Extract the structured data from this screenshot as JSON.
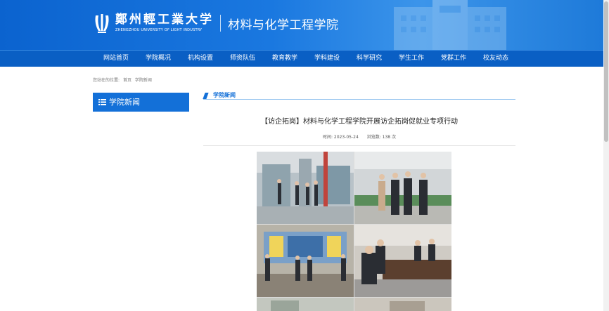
{
  "header": {
    "logo_cn": "鄭州輕工業大学",
    "logo_en": "ZHENGZHOU UNIVERSITY OF LIGHT INDUSTRY",
    "college": "材料与化学工程学院",
    "brand_color": "#1370d8"
  },
  "nav": {
    "items": [
      "网站首页",
      "学院概况",
      "机构设置",
      "师资队伍",
      "教育教学",
      "学科建设",
      "科学研究",
      "学生工作",
      "党群工作",
      "校友动态"
    ]
  },
  "breadcrumb": {
    "prefix": "您站在的位置:",
    "home": "首页",
    "current": "学院新闻"
  },
  "sidebar": {
    "heading": "学院新闻",
    "icon": "list-icon"
  },
  "main": {
    "section_title": "学院新闻",
    "article_title": "【访企拓岗】材料与化学工程学院开展访企拓岗促就业专项行动",
    "date": "时间: 2023-05-24",
    "views": "浏览数: 138 次"
  }
}
